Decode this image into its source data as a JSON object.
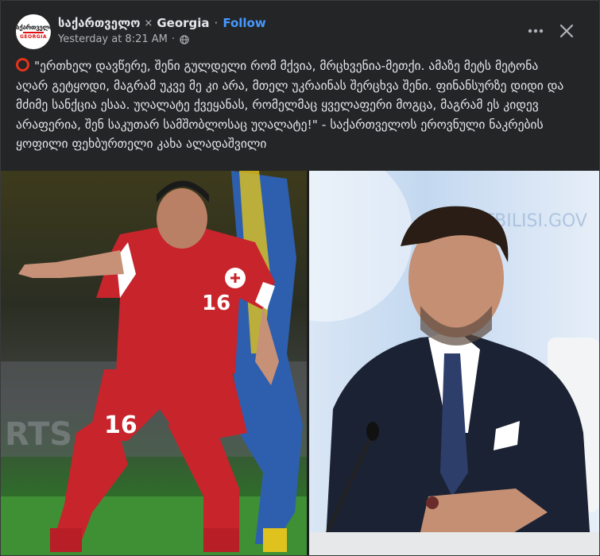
{
  "header": {
    "page_name": "საქართველო",
    "separator": "×",
    "page_name_secondary": "Georgia",
    "dot": "·",
    "follow_label": "Follow",
    "timestamp": "Yesterday at 8:21 AM",
    "timestamp_dot": "·",
    "avatar": {
      "top_text": "საქართველო",
      "bottom_text": "GEORGIA"
    }
  },
  "post": {
    "text": "\"ერთხელ დავწერე, შენი გულდელი რომ მქვია, მრცხვენია-მეთქი. ამაზე მეტს მეტონა აღარ გეტყოდი, მაგრამ უკვე მე კი არა, მთელ უკრაინას შერცხვა შენი. ფინანსურზე დიდი და მძიმე სანქცია ესაა. უღალატე ქვეყანას, რომელმაც ყველაფერი მოგცა, მაგრამ ეს კიდევ არაფერია, შენ საკუთარ სამშობლოსაც უღალატე!\" - საქართველოს ეროვნული ნაკრების ყოფილი ფეხბურთელი კახა ალადაშვილი"
  },
  "photos": {
    "left": {
      "jersey_number": "16",
      "board_text": "RTS"
    },
    "right": {
      "backdrop_text": "WWW.TBILISI.GOV"
    }
  },
  "colors": {
    "background": "#18191a",
    "card": "#242526",
    "accent": "#4599ff",
    "circle": "#e5321b",
    "jersey": "#c8242b"
  },
  "icons": [
    "globe-icon",
    "more-icon",
    "close-icon",
    "circle-icon"
  ]
}
